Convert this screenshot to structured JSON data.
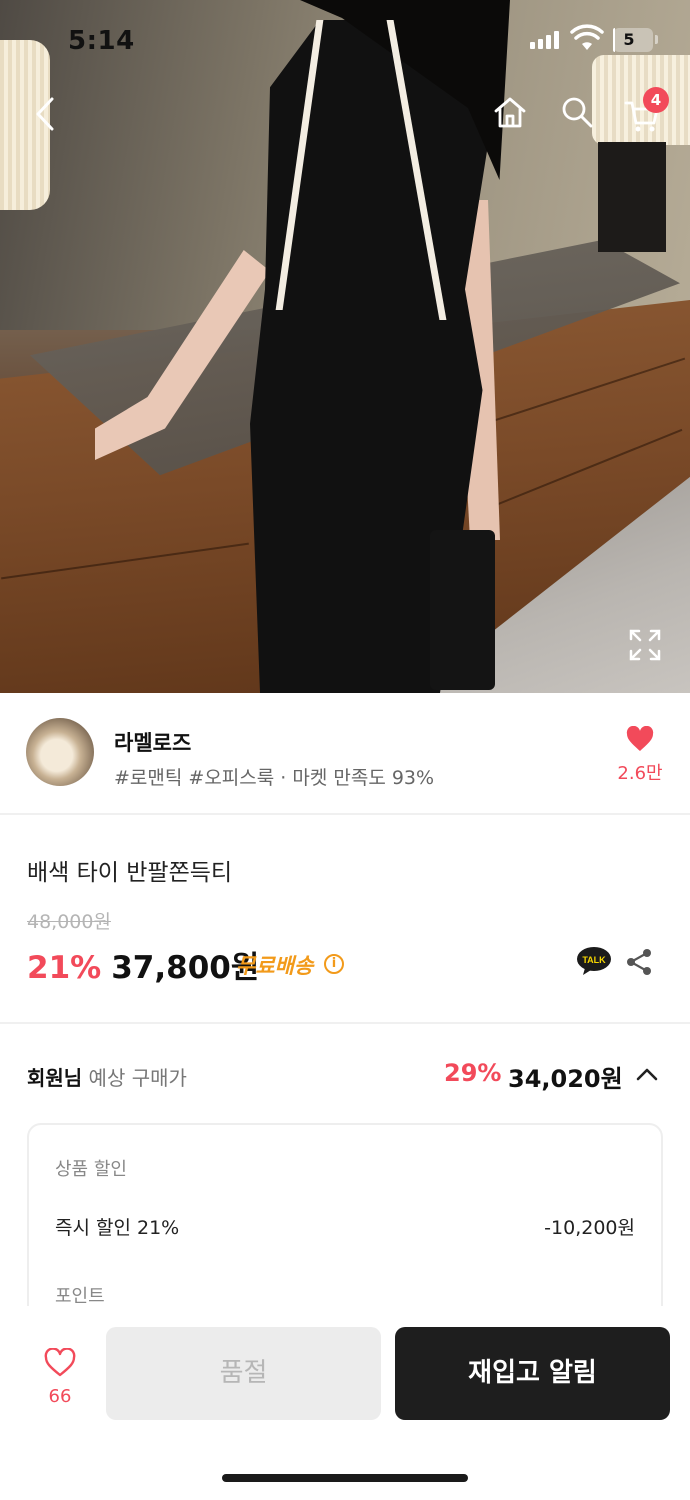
{
  "status_bar": {
    "time": "5:14",
    "battery": "5",
    "battery_level_percent": 5
  },
  "header": {
    "back_icon": "chevron-left-icon",
    "home_icon": "home-icon",
    "search_icon": "search-icon",
    "cart_icon": "cart-icon",
    "cart_count": "4"
  },
  "seller": {
    "name": "라멜로즈",
    "tags": "#로맨틱 #오피스룩 · 마켓 만족도 93%",
    "favorite_count": "2.6만"
  },
  "product": {
    "name": "배색 타이 반팔쫀득티",
    "original_price": "48,000원",
    "discount": "21%",
    "price": "37,800원",
    "shipping": "무료배송",
    "info_mark": "i"
  },
  "member_price": {
    "label_bold": "회원님",
    "label_rest": " 예상 구매가",
    "discount": "29%",
    "price": "34,020원"
  },
  "breakdown": {
    "section_title": "상품 할인",
    "instant_label": "즉시 할인 21%",
    "instant_value": "-10,200원",
    "points_title": "포인트"
  },
  "action_bar": {
    "like_count": "66",
    "soldout_label": "품절",
    "restock_label": "재입고 알림"
  },
  "colors": {
    "accent": "#f24a5a",
    "shipping": "#f29a1a",
    "primary_button": "#1e1e1e"
  }
}
